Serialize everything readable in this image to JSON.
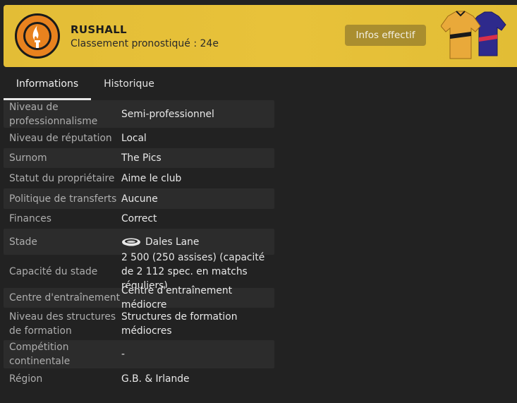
{
  "header": {
    "club_name": "RUSHALL",
    "predicted_position": "Classement pronostiqué : 24e",
    "squad_button": "Infos effectif",
    "crest_icon": "club-crest-icon",
    "kits_icon": "club-kits-icon",
    "background_color": "#e8c23a"
  },
  "tabs": [
    {
      "label": "Informations",
      "active": true
    },
    {
      "label": "Historique",
      "active": false
    }
  ],
  "info": {
    "rows": [
      {
        "label": "Niveau de professionnalisme",
        "value": "Semi-professionnel"
      },
      {
        "label": "Niveau de réputation",
        "value": "Local"
      },
      {
        "label": "Surnom",
        "value": "The Pics"
      },
      {
        "label": "Statut du propriétaire",
        "value": "Aime le club"
      },
      {
        "label": "Politique de transferts",
        "value": "Aucune"
      },
      {
        "label": "Finances",
        "value": "Correct"
      },
      {
        "label": "Stade",
        "value": "Dales Lane",
        "icon": "stadium-icon"
      },
      {
        "label": "Capacité du stade",
        "value": "2 500 (250 assises) (capacité de 2 112 spec. en matchs réguliers)"
      },
      {
        "label": "Centre d'entraînement",
        "value": "Centre d'entraînement médiocre"
      },
      {
        "label": "Niveau des structures de formation",
        "value": "Structures de formation médiocres"
      },
      {
        "label": "Compétition continentale",
        "value": "-"
      },
      {
        "label": "Région",
        "value": "G.B. & Irlande"
      }
    ]
  }
}
